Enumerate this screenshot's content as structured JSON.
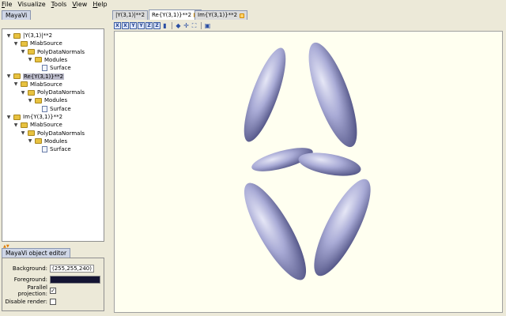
{
  "menubar": {
    "file": {
      "first": "F",
      "rest": "ile"
    },
    "visualize": {
      "first": "",
      "rest": "Visualize"
    },
    "tools": {
      "first": "T",
      "rest": "ools"
    },
    "view": {
      "first": "V",
      "rest": "iew"
    },
    "help": {
      "first": "H",
      "rest": "elp"
    }
  },
  "left_panel": {
    "tab_label": "MayaVi",
    "tree": [
      {
        "label": "|Y(3,1)|**2",
        "icon": "folder-icon",
        "depth": 0
      },
      {
        "label": "MlabSource",
        "icon": "folder-icon",
        "depth": 1
      },
      {
        "label": "PolyDataNormals",
        "icon": "folder-icon",
        "depth": 2
      },
      {
        "label": "Modules",
        "icon": "folder-icon",
        "depth": 3
      },
      {
        "label": "Surface",
        "icon": "document-icon",
        "depth": 4
      },
      {
        "label": "Re{Y(3,1)}**2",
        "icon": "folder-icon",
        "depth": 0,
        "selected": true
      },
      {
        "label": "MlabSource",
        "icon": "folder-icon",
        "depth": 1
      },
      {
        "label": "PolyDataNormals",
        "icon": "folder-icon",
        "depth": 2
      },
      {
        "label": "Modules",
        "icon": "folder-icon",
        "depth": 3
      },
      {
        "label": "Surface",
        "icon": "document-icon",
        "depth": 4
      },
      {
        "label": "Im{Y(3,1)}**2",
        "icon": "folder-icon",
        "depth": 0
      },
      {
        "label": "MlabSource",
        "icon": "folder-icon",
        "depth": 1
      },
      {
        "label": "PolyDataNormals",
        "icon": "folder-icon",
        "depth": 2
      },
      {
        "label": "Modules",
        "icon": "folder-icon",
        "depth": 3
      },
      {
        "label": "Surface",
        "icon": "document-icon",
        "depth": 4
      }
    ]
  },
  "editor": {
    "tab_label": "MayaVi object editor",
    "background_label": "Background:",
    "background_value": "(255,255,240)",
    "foreground_label": "Foreground:",
    "foreground_color": "#141433",
    "parallel_label": "Parallel projection:",
    "parallel_checked": true,
    "disable_render_label": "Disable render:",
    "disable_render_checked": false
  },
  "scene_tabs": [
    {
      "label": "|Y(3,1)|**2",
      "active": false
    },
    {
      "label": "Re{Y(3,1)}**2",
      "active": true
    },
    {
      "label": "Im{Y(3,1)}**2",
      "active": false
    }
  ],
  "toolbar": {
    "view_buttons": [
      "X",
      "X",
      "Y",
      "Y",
      "Z",
      "Z"
    ],
    "icons": [
      "isometric-view-icon",
      "parallel-projection-icon",
      "axes-icon",
      "full-screen-icon",
      "save-icon"
    ]
  },
  "scene": {
    "background_color": "#fffff0",
    "surface_color": "#a9abd6"
  },
  "colors": {
    "accent": "#3d5fa6",
    "selection": "#b9b9c9"
  }
}
